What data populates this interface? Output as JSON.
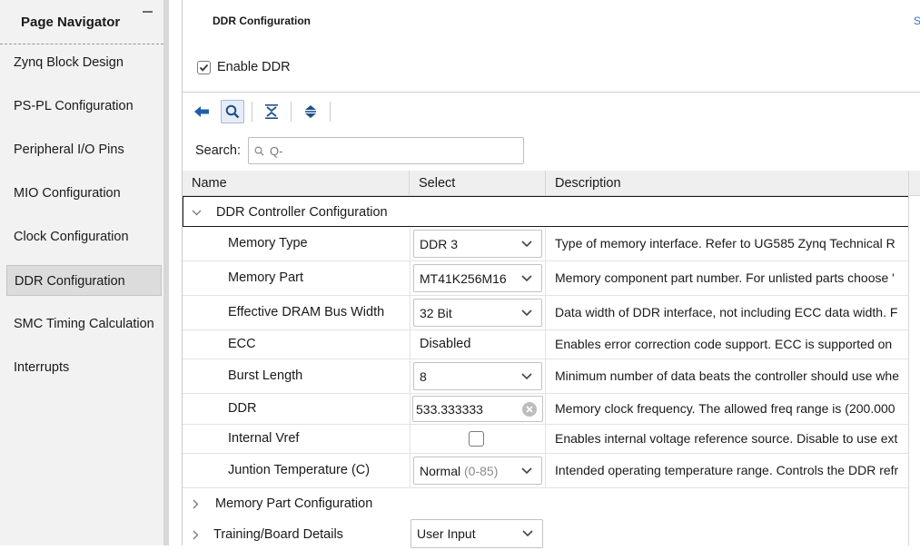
{
  "navigator": {
    "title": "Page Navigator",
    "items": [
      {
        "label": "Zynq Block Design"
      },
      {
        "label": "PS-PL Configuration"
      },
      {
        "label": "Peripheral I/O Pins"
      },
      {
        "label": "MIO Configuration"
      },
      {
        "label": "Clock Configuration"
      },
      {
        "label": "DDR Configuration",
        "selected": true
      },
      {
        "label": "SMC Timing Calculation"
      },
      {
        "label": "Interrupts"
      }
    ]
  },
  "main": {
    "title": "DDR Configuration",
    "top_right_text": "S",
    "enable_ddr": {
      "label": "Enable DDR",
      "checked": true
    },
    "toolbar": [
      "back-icon",
      "search-icon",
      "collapse-all-icon",
      "expand-all-icon"
    ],
    "search": {
      "label": "Search:",
      "placeholder": "Q-"
    }
  },
  "table": {
    "columns": [
      "Name",
      "Select",
      "Description"
    ],
    "groups": [
      {
        "name": "DDR Controller Configuration",
        "expanded": true
      },
      {
        "name": "Memory Part Configuration",
        "expanded": false
      },
      {
        "name": "Training/Board Details",
        "expanded": false,
        "select": "User Input"
      }
    ],
    "rows": [
      {
        "name": "Memory Type",
        "select": "DDR 3",
        "type": "combo",
        "desc": "Type of memory interface. Refer to UG585 Zynq Technical R"
      },
      {
        "name": "Memory Part",
        "select": "MT41K256M16",
        "type": "combo",
        "desc": "Memory component part number. For unlisted parts choose '"
      },
      {
        "name": "Effective DRAM Bus Width",
        "select": "32 Bit",
        "type": "combo",
        "desc": "Data width of DDR interface, not including ECC data width. F"
      },
      {
        "name": "ECC",
        "select": "Disabled",
        "type": "text",
        "desc": "Enables error correction code support. ECC is supported on"
      },
      {
        "name": "Burst Length",
        "select": "8",
        "type": "combo",
        "desc": "Minimum number of data beats the controller should use whe"
      },
      {
        "name": "DDR",
        "select": "533.333333",
        "type": "input",
        "desc": "Memory clock frequency. The allowed freq range is (200.000"
      },
      {
        "name": "Internal Vref",
        "select": "",
        "type": "checkbox",
        "desc": "Enables internal voltage reference source. Disable to use ext"
      },
      {
        "name": "Juntion Temperature (C)",
        "select": "Normal",
        "select_suffix": "(0-85)",
        "type": "combo",
        "desc": "Intended operating temperature range. Controls the DDR refr"
      }
    ]
  }
}
